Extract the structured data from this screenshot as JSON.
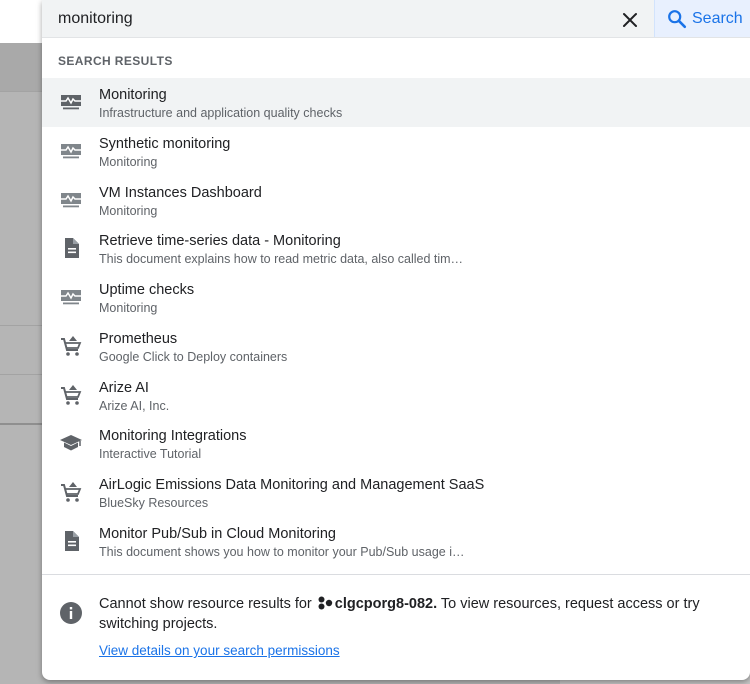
{
  "search": {
    "value": "monitoring",
    "placeholder": "",
    "button_label": "Search"
  },
  "results_section": {
    "title": "SEARCH RESULTS",
    "items": [
      {
        "title": "Monitoring",
        "subtitle": "Infrastructure and application quality checks",
        "icon": "monitoring-icon"
      },
      {
        "title": "Synthetic monitoring",
        "subtitle": "Monitoring",
        "icon": "monitoring-icon"
      },
      {
        "title": "VM Instances Dashboard",
        "subtitle": "Monitoring",
        "icon": "monitoring-icon"
      },
      {
        "title": "Retrieve time-series data - Monitoring",
        "subtitle": "This document explains how to read metric data, also called tim…",
        "icon": "document-icon"
      },
      {
        "title": "Uptime checks",
        "subtitle": "Monitoring",
        "icon": "monitoring-icon"
      },
      {
        "title": "Prometheus",
        "subtitle": "Google Click to Deploy containers",
        "icon": "marketplace-cart-icon"
      },
      {
        "title": "Arize AI",
        "subtitle": "Arize AI, Inc.",
        "icon": "marketplace-cart-icon"
      },
      {
        "title": "Monitoring Integrations",
        "subtitle": "Interactive Tutorial",
        "icon": "tutorial-cap-icon"
      },
      {
        "title": "AirLogic Emissions Data Monitoring and Management SaaS",
        "subtitle": "BlueSky Resources",
        "icon": "marketplace-cart-icon"
      },
      {
        "title": "Monitor Pub/Sub in Cloud Monitoring",
        "subtitle": "This document shows you how to monitor your Pub/Sub usage i…",
        "icon": "document-icon"
      }
    ]
  },
  "notice": {
    "text_before": "Cannot show resource results for ",
    "org_name": "clgcporg8-082.",
    "text_after": " To view resources, request access or try switching projects.",
    "link_label": "View details on your search permissions"
  },
  "colors": {
    "accent": "#1a73e8",
    "search_button_bg": "#e8f0fe",
    "search_bar_bg": "#f1f3f4",
    "active_row_bg": "#f1f3f4",
    "icon": "#5f6368",
    "overlay": "#b5b5b5"
  }
}
